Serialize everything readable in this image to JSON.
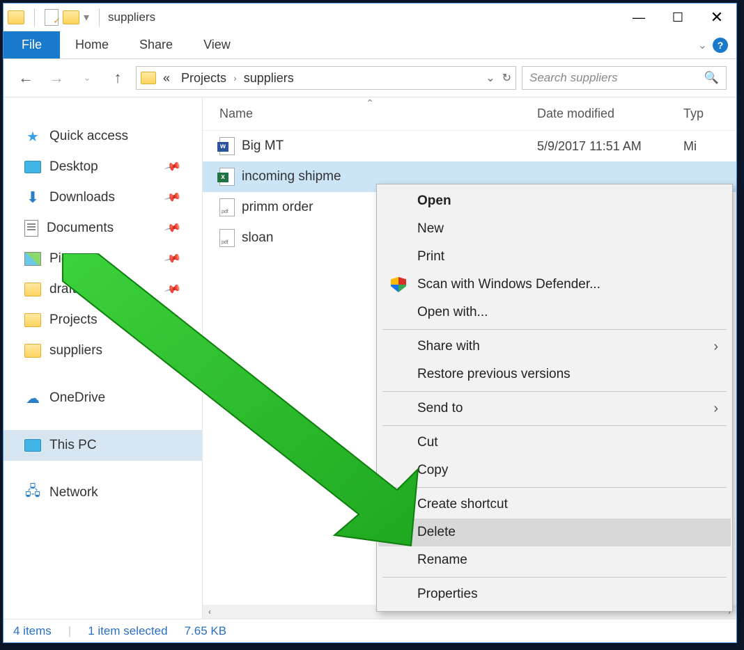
{
  "titlebar": {
    "title": "suppliers"
  },
  "ribbon": {
    "file": "File",
    "tabs": [
      "Home",
      "Share",
      "View"
    ]
  },
  "address": {
    "segment_prefix": "«",
    "segments": [
      "Projects",
      "suppliers"
    ]
  },
  "search": {
    "placeholder": "Search suppliers"
  },
  "sidebar": {
    "quick_access": "Quick access",
    "items": [
      {
        "label": "Desktop",
        "pinned": true
      },
      {
        "label": "Downloads",
        "pinned": true
      },
      {
        "label": "Documents",
        "pinned": true
      },
      {
        "label": "Pictures",
        "pinned": true
      },
      {
        "label": "drafts",
        "pinned": true
      },
      {
        "label": "Projects",
        "pinned": true
      },
      {
        "label": "suppliers",
        "pinned": true
      }
    ],
    "onedrive": "OneDrive",
    "thispc": "This PC",
    "network": "Network"
  },
  "columns": {
    "name": "Name",
    "date": "Date modified",
    "type": "Typ"
  },
  "files": [
    {
      "name": "Big MT",
      "date": "5/9/2017 11:51 AM",
      "type_abbr": "Mi",
      "kind": "word"
    },
    {
      "name": "incoming shipme",
      "date": "",
      "type_abbr": "",
      "kind": "excel",
      "selected": true
    },
    {
      "name": "primm order",
      "date": "",
      "type_abbr": "",
      "kind": "pdf"
    },
    {
      "name": "sloan",
      "date": "",
      "type_abbr": "",
      "kind": "pdf"
    }
  ],
  "context_menu": {
    "open": "Open",
    "new": "New",
    "print": "Print",
    "defender": "Scan with Windows Defender...",
    "open_with": "Open with...",
    "share_with": "Share with",
    "restore": "Restore previous versions",
    "send_to": "Send to",
    "cut": "Cut",
    "copy": "Copy",
    "create_shortcut": "Create shortcut",
    "delete": "Delete",
    "rename": "Rename",
    "properties": "Properties"
  },
  "statusbar": {
    "count": "4 items",
    "selection": "1 item selected",
    "size": "7.65 KB"
  }
}
